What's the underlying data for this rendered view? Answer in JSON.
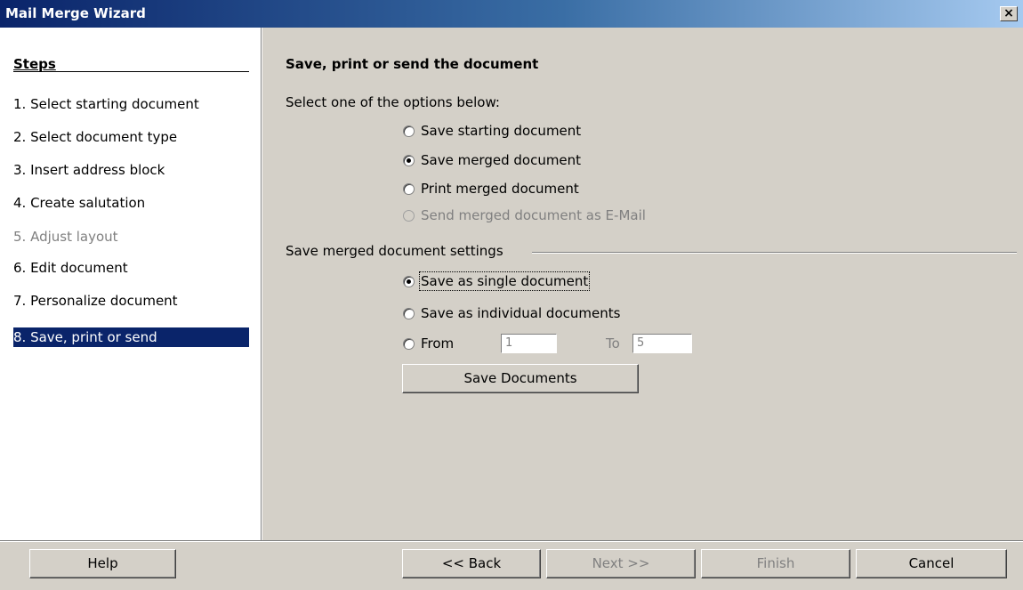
{
  "window": {
    "title": "Mail Merge Wizard",
    "close_label": "×"
  },
  "steps": {
    "title": "Steps",
    "items": [
      {
        "label": "1.  Select starting document",
        "state": "enabled"
      },
      {
        "label": "2.  Select document type",
        "state": "enabled"
      },
      {
        "label": "3.  Insert address block",
        "state": "enabled"
      },
      {
        "label": "4.  Create salutation",
        "state": "enabled"
      },
      {
        "label": "5.  Adjust layout",
        "state": "disabled"
      },
      {
        "label": "6.  Edit document",
        "state": "enabled"
      },
      {
        "label": "7.  Personalize document",
        "state": "enabled"
      },
      {
        "label": "8.  Save, print or send",
        "state": "selected"
      }
    ]
  },
  "main": {
    "title": "Save, print or send the document",
    "prompt": "Select one of the options below:",
    "options": [
      {
        "label": "Save starting document",
        "checked": false,
        "enabled": true
      },
      {
        "label": "Save merged document",
        "checked": true,
        "enabled": true
      },
      {
        "label": "Print merged document",
        "checked": false,
        "enabled": true
      },
      {
        "label": "Send merged document as E-Mail",
        "checked": false,
        "enabled": false
      }
    ],
    "settings_label": "Save merged document settings",
    "settings": {
      "single": "Save as single document",
      "individual": "Save as individual documents",
      "from_label": "From",
      "from_value": "1",
      "to_label": "To",
      "to_value": "5",
      "save_button": "Save Documents"
    }
  },
  "footer": {
    "help": "Help",
    "back": "<< Back",
    "next": "Next >>",
    "finish": "Finish",
    "cancel": "Cancel"
  }
}
